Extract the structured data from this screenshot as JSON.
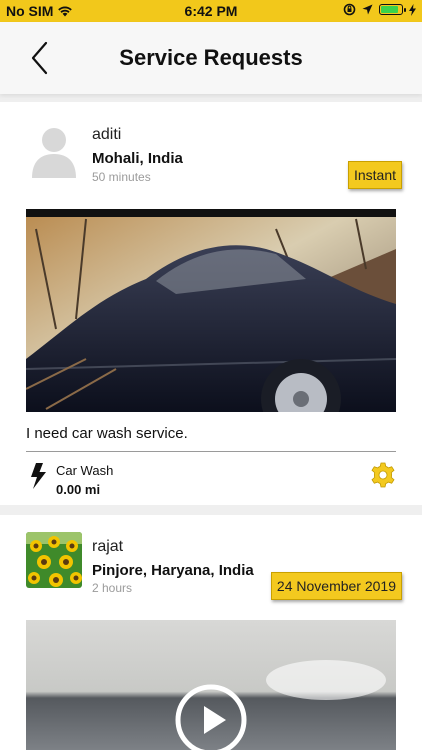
{
  "status_bar": {
    "carrier": "No SIM",
    "time": "6:42 PM",
    "battery_level": 0.9,
    "icons": [
      "wifi-icon",
      "screen-rotation-lock-icon",
      "location-arrow-icon",
      "battery-icon",
      "charging-bolt-icon"
    ]
  },
  "header": {
    "title": "Service Requests",
    "back_icon": "chevron-left-icon"
  },
  "requests": [
    {
      "user_name": "aditi",
      "location": "Mohali, India",
      "time_ago": "50 minutes",
      "tag": "Instant",
      "description": "I need car wash service.",
      "service_name": "Car Wash",
      "distance": "0.00 mi",
      "avatar_icon": "default-user-avatar-icon",
      "service_icon": "lightning-bolt-icon",
      "action_icon": "gear-icon"
    },
    {
      "user_name": "rajat",
      "location": "Pinjore, Haryana, India",
      "time_ago": "2 hours",
      "tag": "24 November 2019",
      "media_icon": "play-button-icon"
    }
  ],
  "colors": {
    "accent": "#f3c91f",
    "status_bar": "#f2c81b",
    "battery": "#3bd34a"
  }
}
